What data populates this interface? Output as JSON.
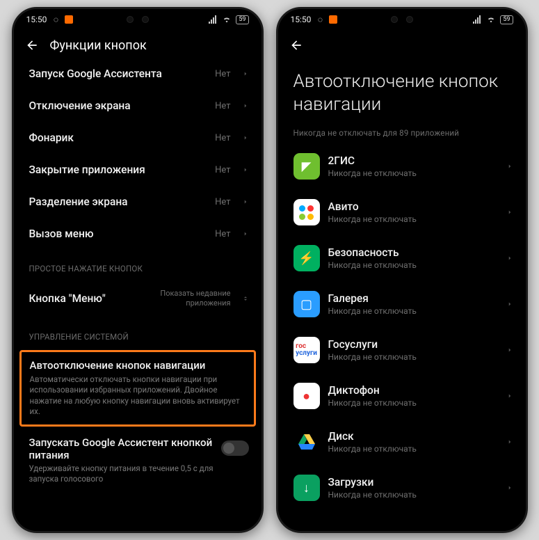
{
  "statusbar": {
    "time": "15:50",
    "battery": "59"
  },
  "left_phone": {
    "header_title": "Функции кнопок",
    "rows": [
      {
        "title": "Запуск Google Ассистента",
        "value": "Нет"
      },
      {
        "title": "Отключение экрана",
        "value": "Нет"
      },
      {
        "title": "Фонарик",
        "value": "Нет"
      },
      {
        "title": "Закрытие приложения",
        "value": "Нет"
      },
      {
        "title": "Разделение экрана",
        "value": "Нет"
      },
      {
        "title": "Вызов меню",
        "value": "Нет"
      }
    ],
    "section1_caption": "ПРОСТОЕ НАЖАТИЕ КНОПОК",
    "menu_button_row": {
      "title": "Кнопка \"Меню\"",
      "value": "Показать недавние\nприложения"
    },
    "section2_caption": "УПРАВЛЕНИЕ СИСТЕМОЙ",
    "highlight": {
      "title": "Автоотключение кнопок навигации",
      "desc": "Автоматически отключать кнопки навигации при использовании избранных приложений. Двойное нажатие на любую кнопку навигации вновь активирует их."
    },
    "assist_toggle": {
      "title": "Запускать Google Ассистент кнопкой питания",
      "desc": "Удерживайте кнопку питания в течение 0,5 с для запуска голосового"
    }
  },
  "right_phone": {
    "page_title": "Автоотключение кнопок навигации",
    "caption": "Никогда не отключать для 89 приложений",
    "never_disable": "Никогда не отключать",
    "apps": [
      {
        "name": "2ГИС",
        "icon_bg": "#6fbf2f",
        "icon_glyph": "◤"
      },
      {
        "name": "Авито",
        "icon_bg": "#ffffff",
        "icon_glyph": "⬤"
      },
      {
        "name": "Безопасность",
        "icon_bg": "#00b060",
        "icon_glyph": "⚡"
      },
      {
        "name": "Галерея",
        "icon_bg": "#2a9dff",
        "icon_glyph": "▢"
      },
      {
        "name": "Госуслуги",
        "icon_bg": "#ffffff",
        "icon_glyph": "гос"
      },
      {
        "name": "Диктофон",
        "icon_bg": "#ffffff",
        "icon_glyph": "●"
      },
      {
        "name": "Диск",
        "icon_bg": "#000000",
        "icon_glyph": "△"
      },
      {
        "name": "Загрузки",
        "icon_bg": "#0aa060",
        "icon_glyph": "↓"
      }
    ]
  }
}
